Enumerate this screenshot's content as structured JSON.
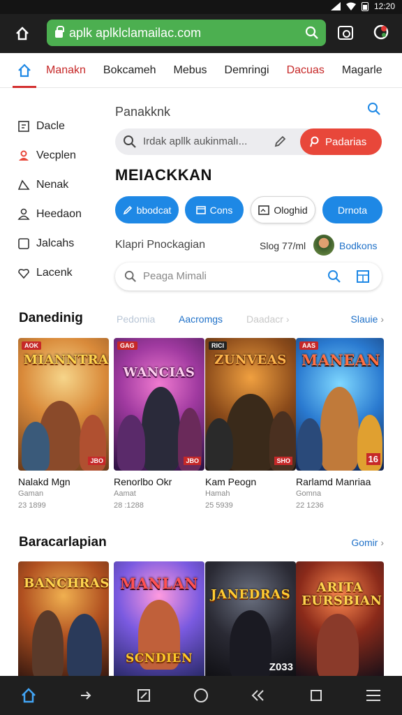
{
  "status": {
    "time": "12:20"
  },
  "browser": {
    "url": "aplk aplklclamailac.com"
  },
  "tabs": [
    "Manakn",
    "Bokcameh",
    "Mebus",
    "Demringi",
    "Dacuas",
    "Magarle"
  ],
  "sidebar": {
    "items": [
      {
        "label": "Dacle",
        "icon": "archive-icon"
      },
      {
        "label": "Vecplen",
        "icon": "people-icon"
      },
      {
        "label": "Nenak",
        "icon": "tag-icon"
      },
      {
        "label": "Heedaon",
        "icon": "person-icon"
      },
      {
        "label": "Jalcahs",
        "icon": "square-icon"
      },
      {
        "label": "Lacenk",
        "icon": "heart-icon"
      }
    ]
  },
  "panel": {
    "title": "Panakknk",
    "search_placeholder": "Irdak apllk aukinmalı...",
    "search_button": "Padarias",
    "heading": "MEIACKKAN",
    "chips": [
      {
        "label": "bbodcat",
        "style": "blue",
        "icon": "pencil-icon"
      },
      {
        "label": "Cons",
        "style": "blue",
        "icon": "grid-icon"
      },
      {
        "label": "Ologhid",
        "style": "white",
        "icon": "folder-icon"
      },
      {
        "label": "Drnota",
        "style": "blue",
        "icon": ""
      }
    ],
    "info_label": "Klapri Pnockagian",
    "info_meta": "Slog 77/ml",
    "user_name": "Bodkons",
    "search2_placeholder": "Peaga Mimali"
  },
  "section1": {
    "title": "Danedinig",
    "filters": [
      "Pedomia",
      "Aacromgs",
      "Daadacr"
    ],
    "see_all": "Slauie",
    "games": [
      {
        "name": "Nalakd Mgn",
        "genre": "Gaman",
        "count": "23 1899",
        "cover_title": "MIANNTRAS",
        "tag": "AOK",
        "badge": "JBO"
      },
      {
        "name": "Renorlbo Okr",
        "genre": "Aamat",
        "count": "28 :1288",
        "cover_title": "WANCIAS",
        "tag": "GAG",
        "badge": "JBO"
      },
      {
        "name": "Kam Peogn",
        "genre": "Hamah",
        "count": "25 5939",
        "cover_title": "ZUNVEAS",
        "tag": "RICI",
        "badge": "SHO"
      },
      {
        "name": "Rarlamd Manriaa",
        "genre": "Gomna",
        "count": "22 1236",
        "cover_title": "MANEAN",
        "tag": "AAS",
        "badge": "16"
      }
    ]
  },
  "section2": {
    "title": "Baracarlapian",
    "see_all": "Gomir",
    "games": [
      {
        "cover_title": "BANCHRAS"
      },
      {
        "cover_title": "MANLAN",
        "footer": "SCNDIEN"
      },
      {
        "cover_title": "JANEDRAS",
        "footer": "Z033"
      },
      {
        "cover_title": "ARITA EURSBIAN"
      }
    ]
  },
  "bottom_nav": [
    "home-icon",
    "forward-icon",
    "edit-icon",
    "circle-icon",
    "back-double-icon",
    "square-icon",
    "menu-icon"
  ]
}
